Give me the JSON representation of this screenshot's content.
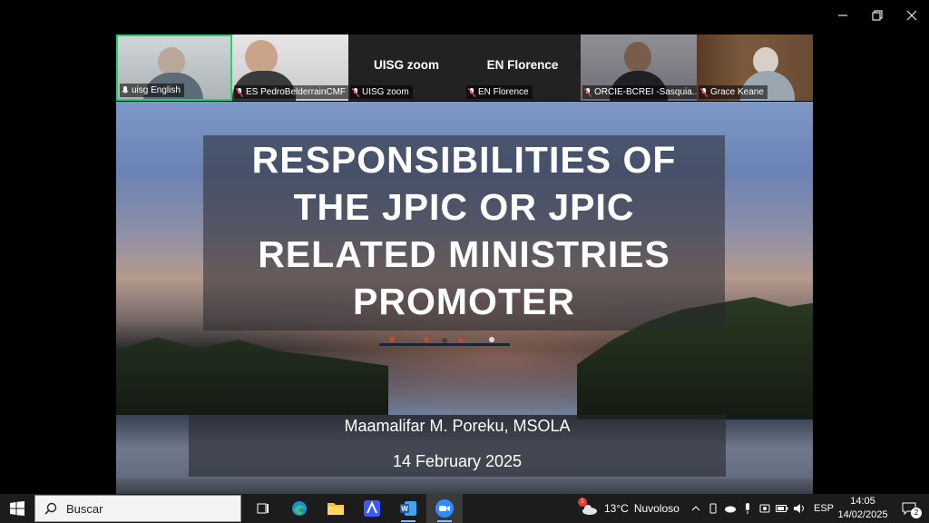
{
  "window": {
    "minimize_icon": "minimize-icon",
    "restore_icon": "restore-icon",
    "close_icon": "close-icon"
  },
  "participants": [
    {
      "name": "uisg English",
      "type": "video",
      "active": true
    },
    {
      "name": "ES PedroBelderrainCMF",
      "type": "video",
      "active": false
    },
    {
      "name": "UISG zoom",
      "type": "name-only",
      "display": "UISG zoom"
    },
    {
      "name": "EN Florence",
      "type": "name-only",
      "display": "EN Florence"
    },
    {
      "name": "ORCIE-BCREI -Sasquia...",
      "type": "video",
      "active": false
    },
    {
      "name": "Grace Keane",
      "type": "video",
      "active": false
    }
  ],
  "slide": {
    "title_lines": [
      "RESPONSIBILITIES OF",
      "THE JPIC OR JPIC",
      "RELATED MINISTRIES",
      "PROMOTER"
    ],
    "author": "Maamalifar M. Poreku, MSOLA",
    "date": "14 February 2025"
  },
  "taskbar": {
    "search_placeholder": "Buscar",
    "apps": [
      "task-view",
      "edge",
      "file-explorer",
      "app-a",
      "word",
      "zoom"
    ],
    "weather": {
      "badge": "1",
      "temp": "13°C",
      "condition": "Nuvoloso"
    },
    "language": "ESP",
    "time": "14:05",
    "date": "14/02/2025",
    "notifications": "2"
  },
  "colors": {
    "active_speaker": "#2ecc71",
    "taskbar": "#1c1c1c",
    "zoom_blue": "#2d8cff"
  }
}
